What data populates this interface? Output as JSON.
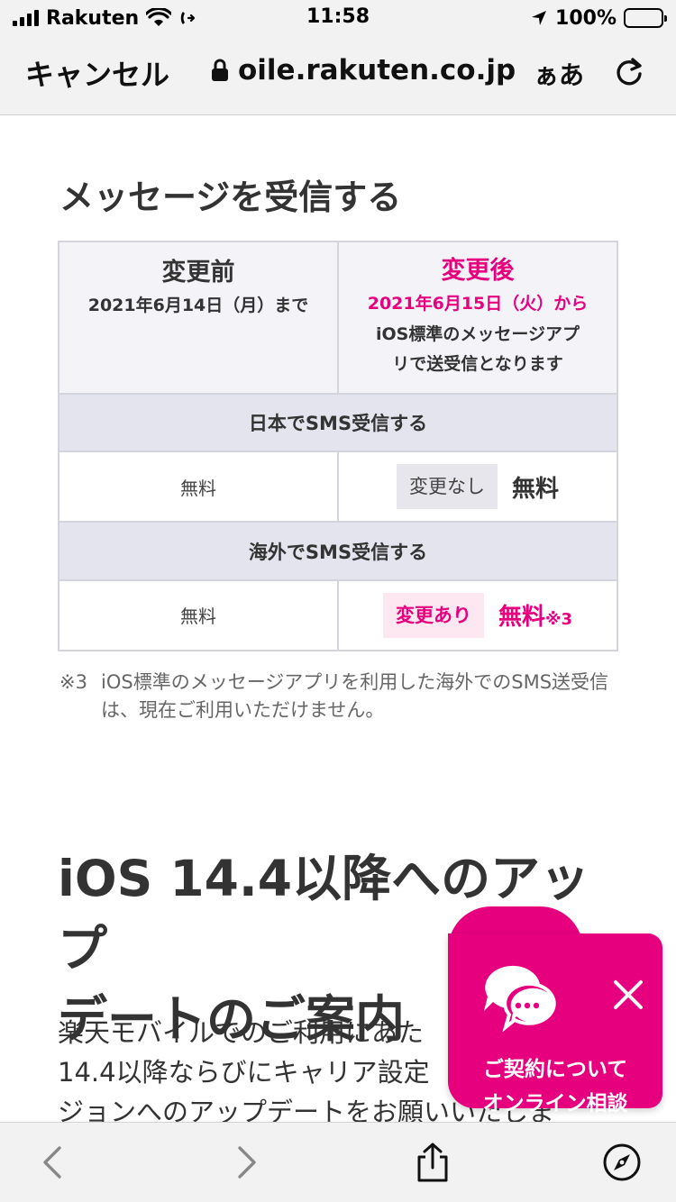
{
  "status_bar": {
    "carrier": "Rakuten",
    "time": "11:58",
    "battery": "100%"
  },
  "browser": {
    "cancel_label": "キャンセル",
    "url": "oile.rakuten.co.jp",
    "text_size_label": "ぁあ"
  },
  "section": {
    "title": "メッセージを受信する"
  },
  "comparison_table": {
    "before": {
      "title": "変更前",
      "date": "2021年6月14日（月）まで"
    },
    "after": {
      "title": "変更後",
      "date": "2021年6月15日（火）から",
      "note_line1": "iOS標準のメッセージアプ",
      "note_line2": "リで送受信となります"
    },
    "rows": [
      {
        "label": "日本でSMS受信する",
        "before_value": "無料",
        "change_badge": "変更なし",
        "after_value": "無料",
        "after_note": ""
      },
      {
        "label": "海外でSMS受信する",
        "before_value": "無料",
        "change_badge": "変更あり",
        "after_value": "無料",
        "after_note": "※3"
      }
    ]
  },
  "footnote": {
    "mark": "※3",
    "text": "iOS標準のメッセージアプリを利用した海外でのSMS送受信は、現在ご利用いただけません。"
  },
  "heading2": {
    "line1": "iOS 14.4以降へのアップ",
    "line2": "デートのご案内"
  },
  "body": {
    "line1": "楽天モバイルでのご利用にあた",
    "line2": "14.4以降ならびにキャリア設定",
    "line3": "ジョンへのアップデートをお願いいたしま"
  },
  "chat_widget": {
    "line1": "ご契約について",
    "line2": "オンライン相談",
    "color": "#e6007e"
  },
  "icons": {
    "back": "chevron-left-icon",
    "forward": "chevron-right-icon",
    "share": "share-icon",
    "safari": "compass-icon",
    "reload": "reload-icon",
    "lock": "lock-icon"
  },
  "colors": {
    "accent": "#e6007e",
    "table_header_bg": "#f4f4f8",
    "row_header_bg": "#e4e4ee"
  }
}
